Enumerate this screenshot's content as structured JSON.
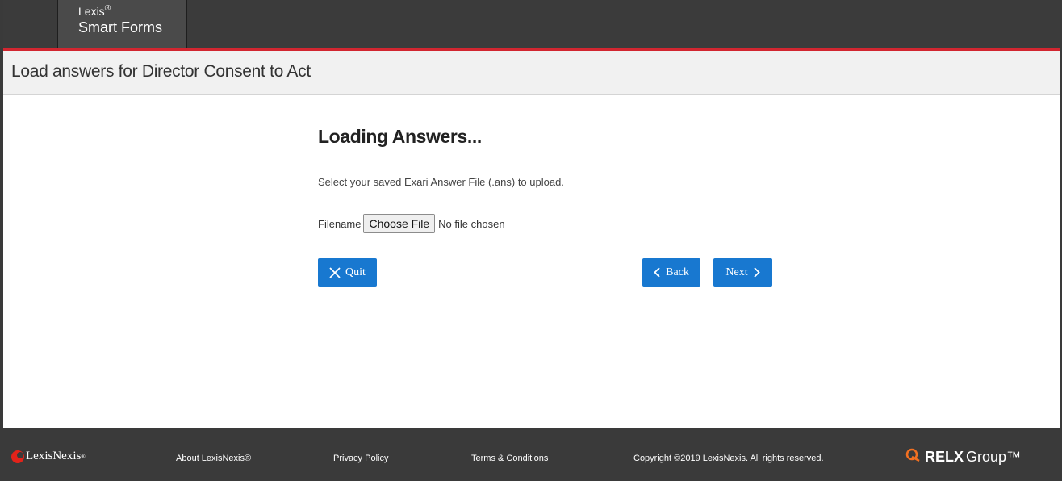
{
  "header": {
    "brand_line1": "Lexis",
    "brand_reg": "®",
    "brand_line2": "Smart Forms",
    "accent_color": "#d22630"
  },
  "title_bar": {
    "title": "Load answers for Director Consent to Act"
  },
  "main": {
    "heading": "Loading Answers...",
    "instruction": "Select your saved Exari Answer File (.ans) to upload.",
    "filename_label": "Filename",
    "choose_file_label": "Choose File",
    "file_status": "No file chosen",
    "quit_label": "Quit",
    "back_label": "Back",
    "next_label": "Next",
    "button_color": "#1878d0"
  },
  "footer": {
    "logo_text": "LexisNexis",
    "logo_reg": "®",
    "about": "About LexisNexis®",
    "privacy": "Privacy Policy",
    "terms": "Terms & Conditions",
    "copyright": "Copyright ©2019 LexisNexis. All rights reserved.",
    "relx_bold": "RELX",
    "relx_light": "Group™"
  }
}
